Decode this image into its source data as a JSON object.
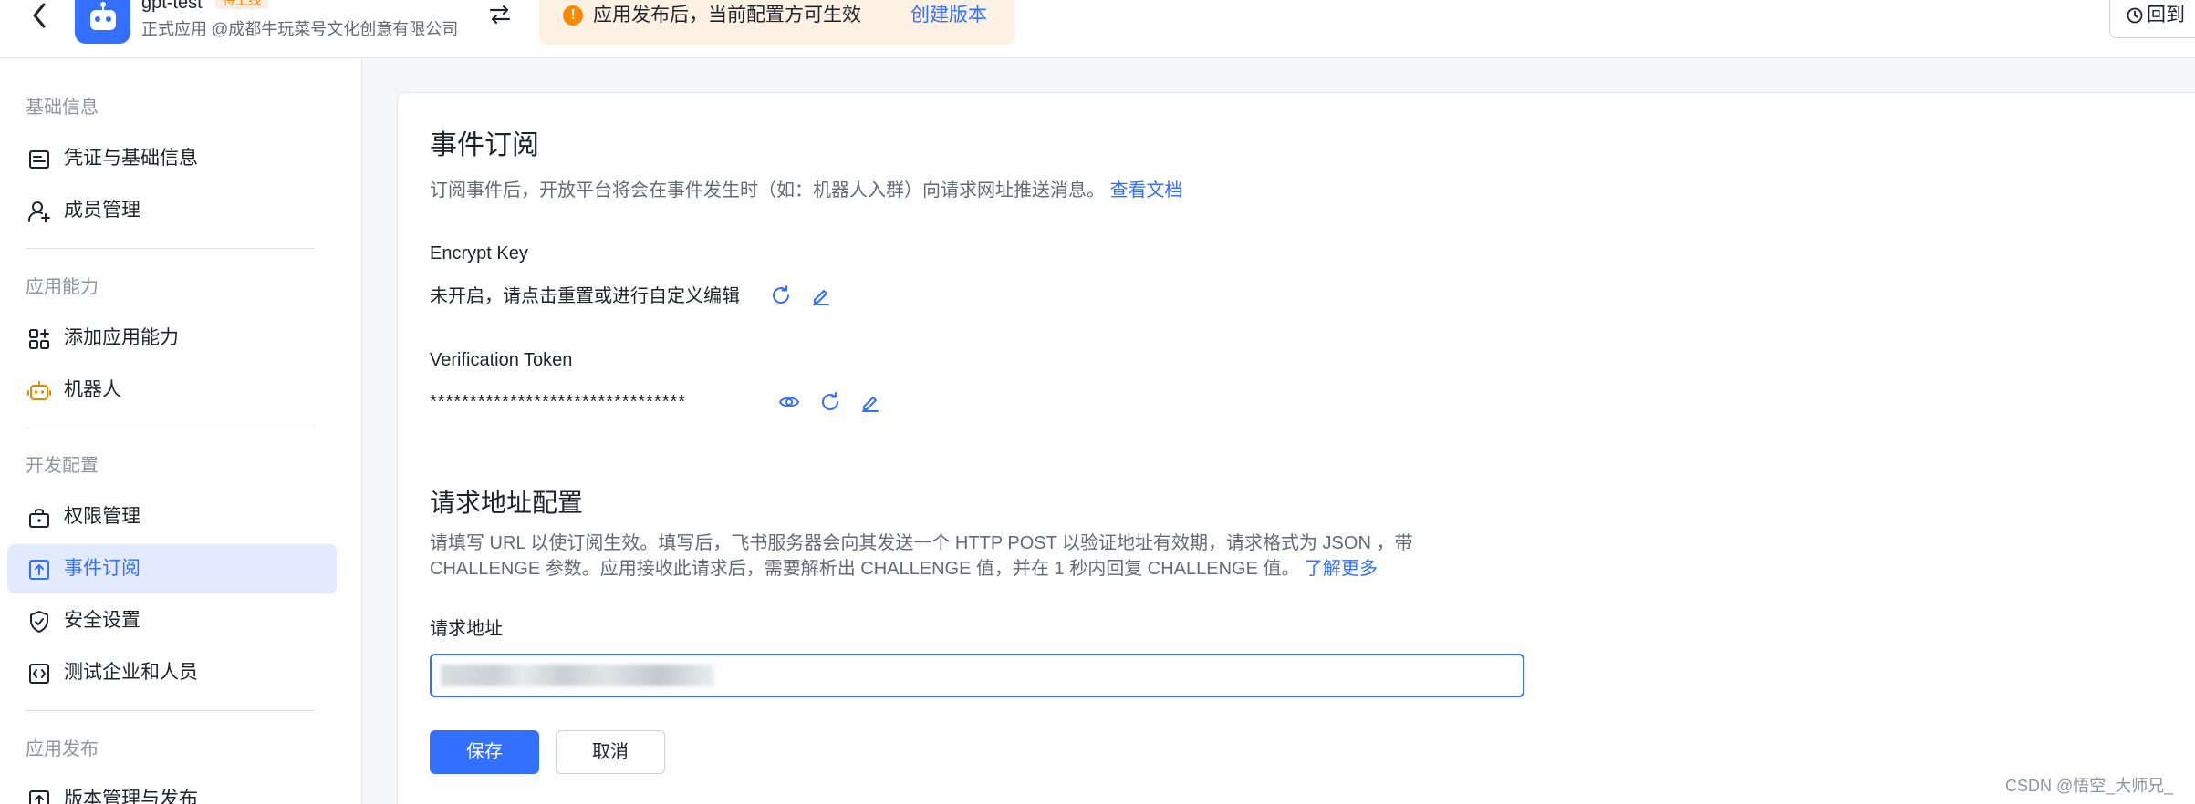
{
  "header": {
    "app_name": "gpt-test",
    "app_status": "待上线",
    "app_subtitle": "正式应用 @成都牛玩菜号文化创意有限公司",
    "banner_text": "应用发布后，当前配置方可生效",
    "banner_link": "创建版本",
    "history_label": "回到"
  },
  "sidebar": {
    "sections": [
      {
        "label": "基础信息",
        "items": [
          {
            "label": "凭证与基础信息",
            "icon": "credential-icon"
          },
          {
            "label": "成员管理",
            "icon": "user-add-icon"
          }
        ]
      },
      {
        "label": "应用能力",
        "items": [
          {
            "label": "添加应用能力",
            "icon": "apps-add-icon"
          },
          {
            "label": "机器人",
            "icon": "robot-icon"
          }
        ]
      },
      {
        "label": "开发配置",
        "items": [
          {
            "label": "权限管理",
            "icon": "permission-icon"
          },
          {
            "label": "事件订阅",
            "icon": "event-subscription-icon",
            "active": true
          },
          {
            "label": "安全设置",
            "icon": "shield-check-icon"
          },
          {
            "label": "测试企业和人员",
            "icon": "code-icon"
          }
        ]
      },
      {
        "label": "应用发布",
        "items": [
          {
            "label": "版本管理与发布",
            "icon": "version-upload-icon"
          }
        ]
      }
    ]
  },
  "main": {
    "title": "事件订阅",
    "description": "订阅事件后，开放平台将会在事件发生时（如：机器人入群）向请求网址推送消息。",
    "description_link": "查看文档",
    "encrypt_key_label": "Encrypt Key",
    "encrypt_key_value": "未开启，请点击重置或进行自定义编辑",
    "verification_token_label": "Verification Token",
    "verification_token_value": "********************************",
    "request_section_title": "请求地址配置",
    "request_desc_line1": "请填写 URL 以使订阅生效。填写后，飞书服务器会向其发送一个 HTTP POST 以验证地址有效期，请求格式为 JSON ，带",
    "request_desc_line2": "CHALLENGE 参数。应用接收此请求后，需要解析出 CHALLENGE 值，并在 1 秒内回复 CHALLENGE 值。",
    "request_desc_link": "了解更多",
    "request_url_label": "请求地址",
    "save_label": "保存",
    "cancel_label": "取消"
  },
  "watermark": "CSDN @悟空_大师兄_",
  "colors": {
    "accent": "#3370ff",
    "warning": "#ff8800",
    "banner_bg": "#fdf1e4",
    "active_bg": "#e1eaff"
  }
}
